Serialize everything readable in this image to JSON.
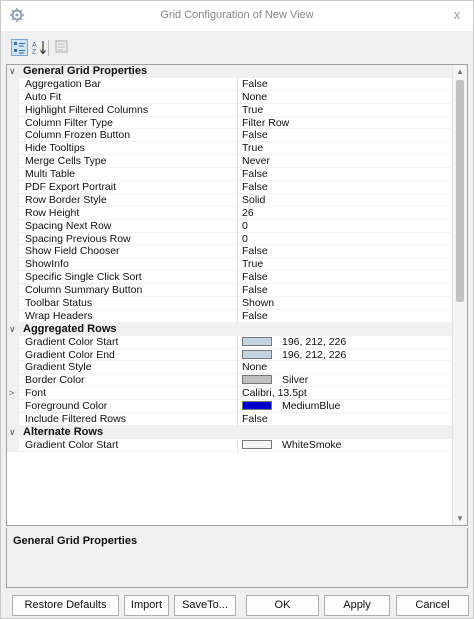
{
  "window": {
    "title": "Grid Configuration of New View",
    "close_glyph": "x"
  },
  "toolbar": {
    "categorized_icon": "categorized-icon",
    "alphabetical_icon": "sort-alpha-icon",
    "property_pages_icon": "property-pages-icon"
  },
  "grid": {
    "rows": [
      {
        "type": "category",
        "expanded": true,
        "name": "General Grid Properties"
      },
      {
        "type": "prop",
        "name": "Aggregation Bar",
        "value": "False"
      },
      {
        "type": "prop",
        "name": "Auto Fit",
        "value": "None"
      },
      {
        "type": "prop",
        "name": "Highlight Filtered Columns",
        "value": "True"
      },
      {
        "type": "prop",
        "name": "Column Filter Type",
        "value": "Filter Row"
      },
      {
        "type": "prop",
        "name": "Column Frozen Button",
        "value": "False"
      },
      {
        "type": "prop",
        "name": "Hide Tooltips",
        "value": "True"
      },
      {
        "type": "prop",
        "name": "Merge Cells Type",
        "value": "Never"
      },
      {
        "type": "prop",
        "name": "Multi Table",
        "value": "False"
      },
      {
        "type": "prop",
        "name": "PDF Export Portrait",
        "value": "False"
      },
      {
        "type": "prop",
        "name": "Row Border Style",
        "value": "Solid"
      },
      {
        "type": "prop",
        "name": "Row Height",
        "value": "26"
      },
      {
        "type": "prop",
        "name": "Spacing Next Row",
        "value": "0"
      },
      {
        "type": "prop",
        "name": "Spacing Previous Row",
        "value": "0"
      },
      {
        "type": "prop",
        "name": "Show Field Chooser",
        "value": "False"
      },
      {
        "type": "prop",
        "name": "ShowInfo",
        "value": "True"
      },
      {
        "type": "prop",
        "name": "Specific Single Click Sort",
        "value": "False"
      },
      {
        "type": "prop",
        "name": "Column Summary Button",
        "value": "False"
      },
      {
        "type": "prop",
        "name": "Toolbar Status",
        "value": "Shown"
      },
      {
        "type": "prop",
        "name": "Wrap Headers",
        "value": "False"
      },
      {
        "type": "category",
        "expanded": true,
        "name": "Aggregated Rows"
      },
      {
        "type": "prop",
        "name": "Gradient Color Start",
        "value": "196, 212, 226",
        "swatch": "#c4d4e2"
      },
      {
        "type": "prop",
        "name": "Gradient Color End",
        "value": "196, 212, 226",
        "swatch": "#c4d4e2"
      },
      {
        "type": "prop",
        "name": "Gradient Style",
        "value": "None"
      },
      {
        "type": "prop",
        "name": "Border Color",
        "value": "Silver",
        "swatch": "#c0c0c0"
      },
      {
        "type": "prop",
        "name": "Font",
        "value": "Calibri, 13.5pt",
        "expandable": true
      },
      {
        "type": "prop",
        "name": "Foreground Color",
        "value": "MediumBlue",
        "swatch": "#0000cd"
      },
      {
        "type": "prop",
        "name": "Include Filtered Rows",
        "value": "False"
      },
      {
        "type": "category",
        "expanded": true,
        "name": "Alternate Rows"
      },
      {
        "type": "prop",
        "name": "Gradient Color Start",
        "value": "WhiteSmoke",
        "swatch": "#f5f5f5"
      }
    ]
  },
  "description": {
    "title": "General Grid Properties"
  },
  "buttons": {
    "restore_defaults": "Restore Defaults",
    "import": "Import",
    "save_to": "SaveTo...",
    "ok": "OK",
    "apply": "Apply",
    "cancel": "Cancel"
  },
  "glyphs": {
    "expanded": "∨",
    "collapsed": ">"
  }
}
